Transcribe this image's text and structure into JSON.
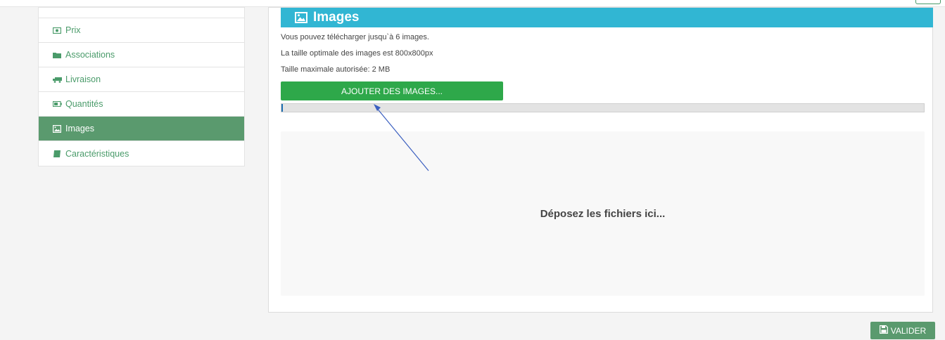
{
  "colors": {
    "sidebar_text": "#4a9b6a",
    "sidebar_active_bg": "#5a9a6e",
    "header_bg": "#31b6d3",
    "add_button_bg": "#2ea84a",
    "valider_bg": "#5a9a6e",
    "arrow": "#3b5fc0"
  },
  "sidebar": {
    "items": [
      {
        "label": "Prix",
        "icon": "money-icon",
        "active": false
      },
      {
        "label": "Associations",
        "icon": "folder-icon",
        "active": false
      },
      {
        "label": "Livraison",
        "icon": "truck-icon",
        "active": false
      },
      {
        "label": "Quantités",
        "icon": "battery-icon",
        "active": false
      },
      {
        "label": "Images",
        "icon": "image-icon",
        "active": true
      },
      {
        "label": "Caractéristiques",
        "icon": "book-icon",
        "active": false
      }
    ]
  },
  "panel": {
    "title": "Images",
    "info": [
      "Vous pouvez télécharger jusqu`à 6 images.",
      "La taille optimale des images est 800x800px",
      "Taille maximale autorisée: 2 MB"
    ],
    "add_button": "AJOUTER DES IMAGES...",
    "progress": 0.002,
    "dropzone_text": "Déposez les fichiers ici..."
  },
  "footer": {
    "valider": "VALIDER"
  }
}
